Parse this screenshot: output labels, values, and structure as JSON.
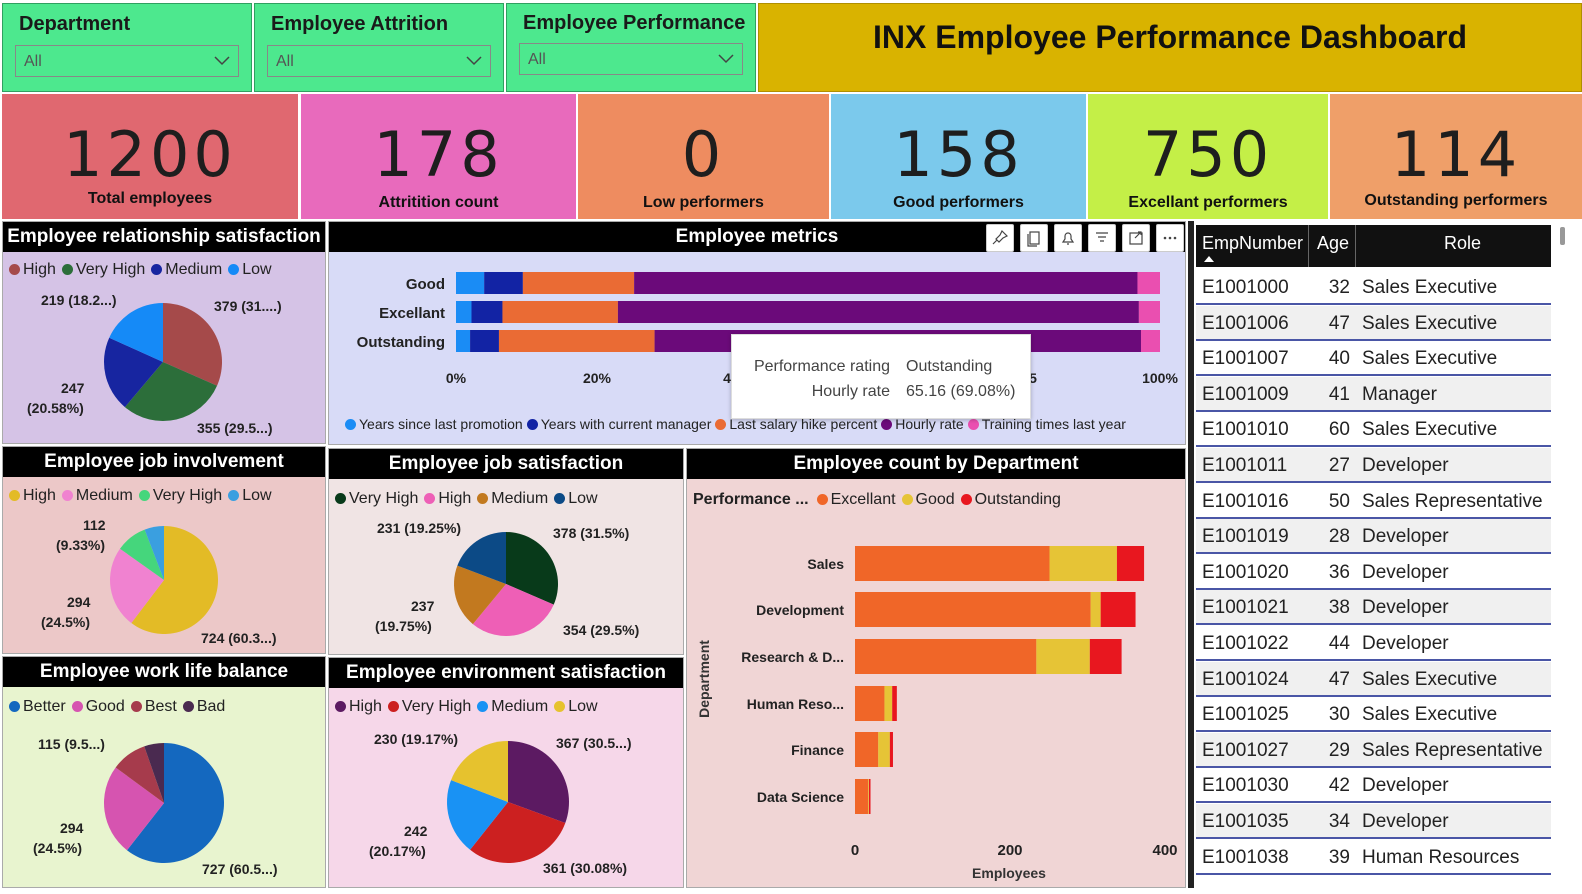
{
  "slicers": [
    {
      "title": "Department",
      "value": "All"
    },
    {
      "title": "Employee Attrition",
      "value": "All"
    },
    {
      "title": "Employee Performance",
      "value": "All"
    }
  ],
  "title": "INX Employee Performance Dashboard",
  "kpis": [
    {
      "value": "1200",
      "label": "Total employees",
      "color": "#e06870"
    },
    {
      "value": "178",
      "label": "Attritition count",
      "color": "#e86abc"
    },
    {
      "value": "0",
      "label": "Low performers",
      "color": "#ee8c60"
    },
    {
      "value": "158",
      "label": "Good performers",
      "color": "#7bc9ec"
    },
    {
      "value": "750",
      "label": "Excellant performers",
      "color": "#c4ef47"
    },
    {
      "value": "114",
      "label": "Outstanding performers",
      "color": "#ef9f69"
    }
  ],
  "relationship": {
    "title": "Employee relationship satisfaction",
    "legend": [
      {
        "name": "High",
        "color": "#a54a4a"
      },
      {
        "name": "Very High",
        "color": "#2c6e3a"
      },
      {
        "name": "Medium",
        "color": "#1725a0"
      },
      {
        "name": "Low",
        "color": "#158af7"
      }
    ],
    "labels": [
      "219 (18.2...)",
      "379 (31....)",
      "247",
      "(20.58%)",
      "355 (29.5...)"
    ]
  },
  "involvement": {
    "title": "Employee job involvement",
    "legend": [
      {
        "name": "High",
        "color": "#e3bb26"
      },
      {
        "name": "Medium",
        "color": "#f082d0"
      },
      {
        "name": "Very High",
        "color": "#45d67c"
      },
      {
        "name": "Low",
        "color": "#3a9fe0"
      }
    ],
    "labels": [
      "112",
      "(9.33%)",
      "294",
      "(24.5%)",
      "724 (60.3...)"
    ]
  },
  "worklife": {
    "title": "Employee work life balance",
    "legend": [
      {
        "name": "Better",
        "color": "#1468bf"
      },
      {
        "name": "Good",
        "color": "#d654b0"
      },
      {
        "name": "Best",
        "color": "#a63b4c"
      },
      {
        "name": "Bad",
        "color": "#4a2a50"
      }
    ],
    "labels": [
      "115 (9.5...)",
      "294",
      "(24.5%)",
      "727 (60.5...)"
    ]
  },
  "jobsat": {
    "title": "Employee job satisfaction",
    "legend": [
      {
        "name": "Very High",
        "color": "#083a1a"
      },
      {
        "name": "High",
        "color": "#ee5fb6"
      },
      {
        "name": "Medium",
        "color": "#c2791f"
      },
      {
        "name": "Low",
        "color": "#0c4a86"
      }
    ],
    "labels": [
      "231 (19.25%)",
      "378 (31.5%)",
      "237",
      "(19.75%)",
      "354 (29.5%)"
    ]
  },
  "envsat": {
    "title": "Employee environment satisfaction",
    "legend": [
      {
        "name": "High",
        "color": "#5c1a62"
      },
      {
        "name": "Very High",
        "color": "#cc2020"
      },
      {
        "name": "Medium",
        "color": "#1992f4"
      },
      {
        "name": "Low",
        "color": "#e6c22e"
      }
    ],
    "labels": [
      "230 (19.17%)",
      "367 (30.5...)",
      "242",
      "(20.17%)",
      "361 (30.08%)"
    ]
  },
  "metrics": {
    "title": "Employee metrics",
    "rows": [
      "Good",
      "Excellant",
      "Outstanding"
    ],
    "xticks": [
      "0%",
      "20%",
      "4",
      "5",
      "100%"
    ],
    "legend": [
      "Years since last promotion",
      "Years with current manager",
      "Last salary hike percent",
      "Hourly rate",
      "Training times last year"
    ],
    "legend_colors": [
      "#1a8cf5",
      "#1223a4",
      "#ea6b34",
      "#6b0a7a",
      "#ea4fb0"
    ],
    "tooltip": {
      "k1": "Performance rating",
      "v1": "Outstanding",
      "k2": "Hourly rate",
      "v2": "65.16 (69.08%)"
    }
  },
  "dept": {
    "title": "Employee count by Department",
    "legend_title": "Performance ...",
    "legend": [
      {
        "name": "Excellant",
        "color": "#f06628"
      },
      {
        "name": "Good",
        "color": "#e6c436"
      },
      {
        "name": "Outstanding",
        "color": "#e8171f"
      }
    ],
    "categories": [
      "Sales",
      "Development",
      "Research & D...",
      "Human Reso...",
      "Finance",
      "Data Science"
    ],
    "xticks": [
      "0",
      "200",
      "400"
    ],
    "xlabel": "Employees",
    "ylabel": "Department"
  },
  "table": {
    "headers": [
      "EmpNumber",
      "Age",
      "Role"
    ],
    "rows": [
      [
        "E1001000",
        "32",
        "Sales Executive"
      ],
      [
        "E1001006",
        "47",
        "Sales Executive"
      ],
      [
        "E1001007",
        "40",
        "Sales Executive"
      ],
      [
        "E1001009",
        "41",
        "Manager"
      ],
      [
        "E1001010",
        "60",
        "Sales Executive"
      ],
      [
        "E1001011",
        "27",
        "Developer"
      ],
      [
        "E1001016",
        "50",
        "Sales Representative"
      ],
      [
        "E1001019",
        "28",
        "Developer"
      ],
      [
        "E1001020",
        "36",
        "Developer"
      ],
      [
        "E1001021",
        "38",
        "Developer"
      ],
      [
        "E1001022",
        "44",
        "Developer"
      ],
      [
        "E1001024",
        "47",
        "Sales Executive"
      ],
      [
        "E1001025",
        "30",
        "Sales Executive"
      ],
      [
        "E1001027",
        "29",
        "Sales Representative"
      ],
      [
        "E1001030",
        "42",
        "Developer"
      ],
      [
        "E1001035",
        "34",
        "Developer"
      ],
      [
        "E1001038",
        "39",
        "Human Resources"
      ]
    ]
  },
  "chart_data": [
    {
      "type": "pie",
      "title": "Employee relationship satisfaction",
      "categories": [
        "High",
        "Very High",
        "Medium",
        "Low"
      ],
      "values": [
        379,
        355,
        247,
        219
      ]
    },
    {
      "type": "pie",
      "title": "Employee job involvement",
      "categories": [
        "High",
        "Medium",
        "Very High",
        "Low"
      ],
      "values": [
        724,
        294,
        112,
        70
      ]
    },
    {
      "type": "pie",
      "title": "Employee work life balance",
      "categories": [
        "Better",
        "Good",
        "Best",
        "Bad"
      ],
      "values": [
        727,
        294,
        115,
        64
      ]
    },
    {
      "type": "pie",
      "title": "Employee job satisfaction",
      "categories": [
        "Very High",
        "High",
        "Medium",
        "Low"
      ],
      "values": [
        378,
        354,
        237,
        231
      ]
    },
    {
      "type": "pie",
      "title": "Employee environment satisfaction",
      "categories": [
        "High",
        "Very High",
        "Medium",
        "Low"
      ],
      "values": [
        367,
        361,
        242,
        230
      ]
    },
    {
      "type": "bar",
      "title": "Employee metrics",
      "stacked": "100%",
      "categories": [
        "Good",
        "Excellant",
        "Outstanding"
      ],
      "series": [
        {
          "name": "Years since last promotion",
          "values": [
            4,
            2.2,
            2
          ]
        },
        {
          "name": "Years with current manager",
          "values": [
            5.5,
            4.4,
            4.1
          ]
        },
        {
          "name": "Last salary hike percent",
          "values": [
            15.8,
            16.4,
            22.1
          ]
        },
        {
          "name": "Hourly rate",
          "values": [
            71.5,
            74,
            69.08
          ]
        },
        {
          "name": "Training times last year",
          "values": [
            3.2,
            3,
            2.7
          ]
        }
      ]
    },
    {
      "type": "bar",
      "title": "Employee count by Department",
      "orientation": "horizontal",
      "stacked": true,
      "categories": [
        "Sales",
        "Development",
        "Research & D...",
        "Human Reso...",
        "Finance",
        "Data Science"
      ],
      "series": [
        {
          "name": "Excellant",
          "values": [
            251,
            304,
            234,
            38,
            30,
            17
          ]
        },
        {
          "name": "Good",
          "values": [
            87,
            13,
            69,
            10,
            15,
            1
          ]
        },
        {
          "name": "Outstanding",
          "values": [
            35,
            45,
            41,
            6,
            4,
            2
          ]
        }
      ],
      "xlim": [
        0,
        400
      ],
      "xlabel": "Employees",
      "ylabel": "Department"
    }
  ]
}
